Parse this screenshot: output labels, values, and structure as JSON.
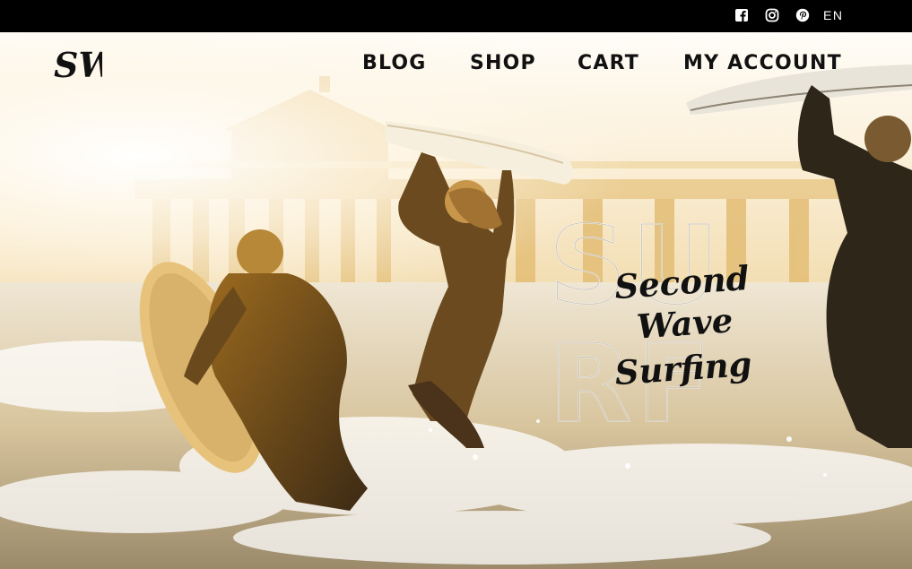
{
  "topbar": {
    "social": [
      {
        "icon": "facebook-icon"
      },
      {
        "icon": "instagram-icon"
      },
      {
        "icon": "pinterest-icon"
      }
    ],
    "language": "EN"
  },
  "header": {
    "logo_text": "SW",
    "nav": [
      {
        "label": "BLOG"
      },
      {
        "label": "SHOP"
      },
      {
        "label": "CART"
      },
      {
        "label": "MY ACCOUNT"
      }
    ]
  },
  "hero": {
    "watermark_line1": "SU",
    "watermark_line2": "RF",
    "brand_line1": "Second Wave",
    "brand_line2": "Surfing"
  }
}
